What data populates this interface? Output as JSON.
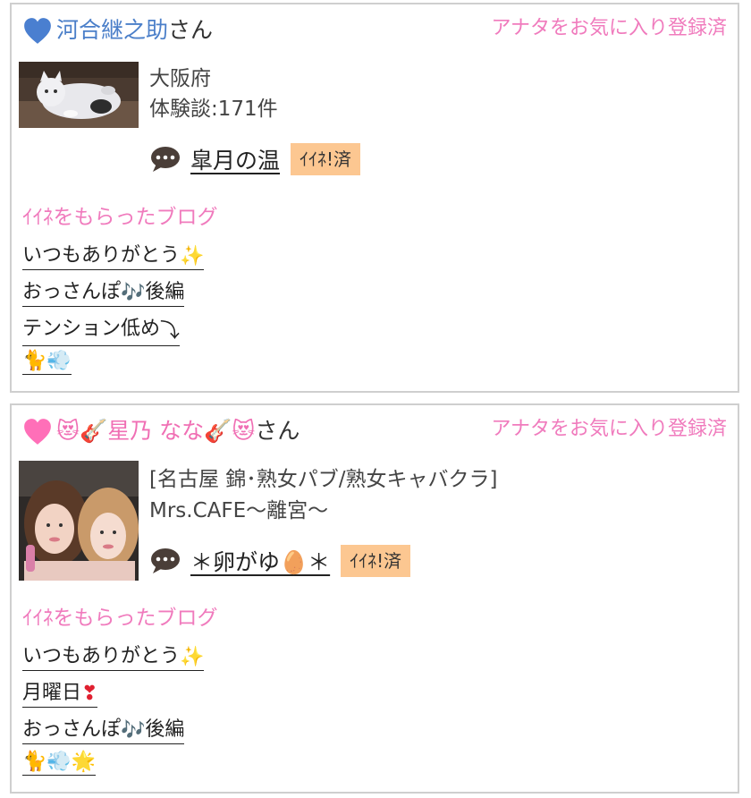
{
  "cards": [
    {
      "heart_color": "#4a7fd0",
      "user_name": "河合継之助",
      "suffix": "さん",
      "fav_status": "アナタをお気に入り登録済",
      "thumbnail": "white-cat-figurine-photo",
      "info_lines": [
        "大阪府",
        "体験談:171件"
      ],
      "blog_title": "皐月の温",
      "iine_label": "ｲｲﾈ!済",
      "section_title": "ｲｲﾈをもらったブログ",
      "links": [
        {
          "text": "いつもありがとう",
          "emoji": "sparkles-icon"
        },
        {
          "text": "おっさんぽ",
          "emoji": "music-notes-icon",
          "after": "後編"
        },
        {
          "text": "テンション低め",
          "emoji": "down-arrow-icon"
        },
        {
          "text": "",
          "emoji": "cat-and-dash-icon"
        }
      ]
    },
    {
      "heart_color": "#ff6fb8",
      "user_name": "😻🎸星乃 なな🎸😻",
      "suffix": "さん",
      "fav_status": "アナタをお気に入り登録済",
      "thumbnail": "two-women-selfie-photo",
      "info_lines": [
        "[名古屋 錦･熟女パブ/熟女キャバクラ]",
        "Mrs.CAFE〜離宮〜"
      ],
      "blog_title": "＊卵がゆ🥚＊",
      "iine_label": "ｲｲﾈ!済",
      "section_title": "ｲｲﾈをもらったブログ",
      "links": [
        {
          "text": "いつもありがとう",
          "emoji": "sparkles-icon"
        },
        {
          "text": "月曜日",
          "emoji": "red-exclamation-icon"
        },
        {
          "text": "おっさんぽ",
          "emoji": "music-notes-icon",
          "after": "後編"
        },
        {
          "text": "",
          "emoji": "cat-dash-star-icon"
        }
      ]
    }
  ]
}
